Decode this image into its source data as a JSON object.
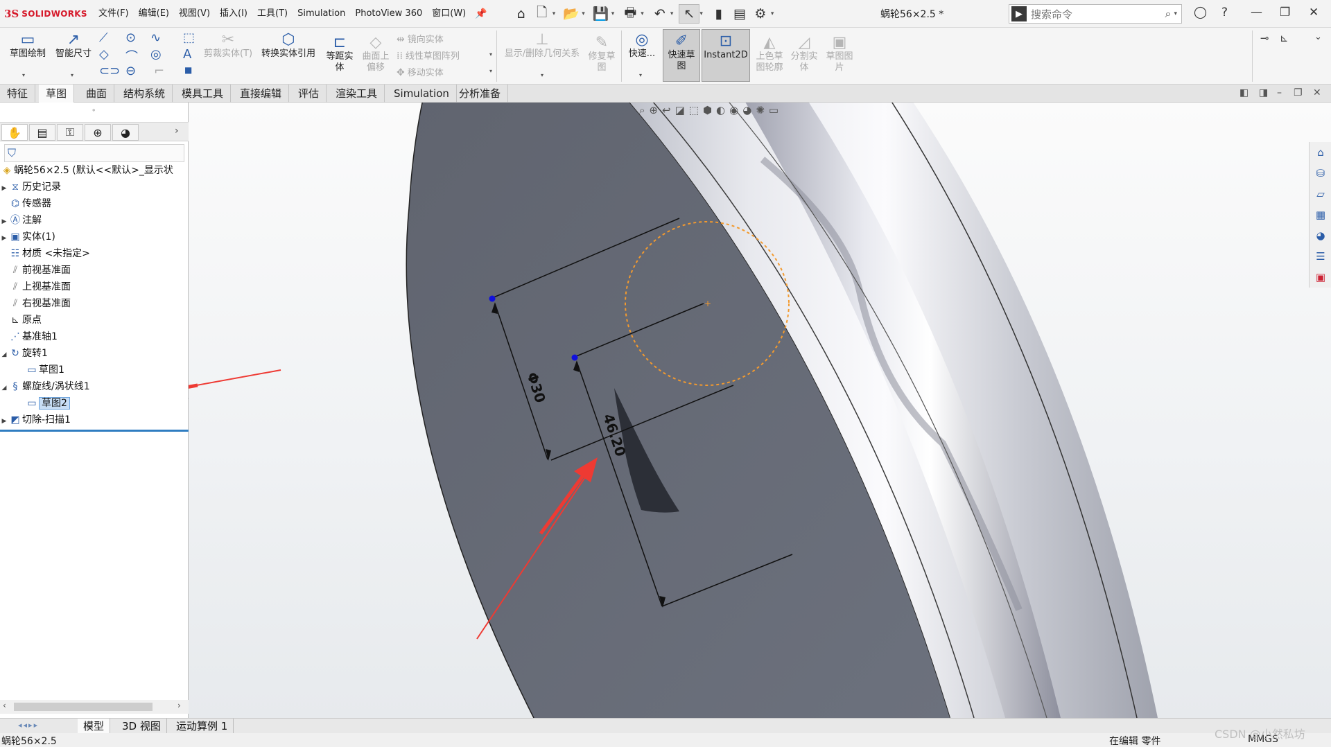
{
  "app": {
    "logo_prefix": "3S",
    "logo_name": "SOLIDWORKS",
    "document_title": "蜗轮56×2.5 *"
  },
  "menu": {
    "items": [
      "文件(F)",
      "编辑(E)",
      "视图(V)",
      "插入(I)",
      "工具(T)",
      "Simulation",
      "PhotoView 360",
      "窗口(W)"
    ]
  },
  "search": {
    "placeholder": "搜索命令"
  },
  "commands": {
    "sketch": "草图绘制",
    "smart_dim": "智能尺寸",
    "trim": "剪裁实体(T)",
    "convert": "转换实体引用",
    "offset_l1": "等距实",
    "offset_l2": "体",
    "offset_surf_l1": "曲面上",
    "offset_surf_l2": "偏移",
    "mirror": "镜向实体",
    "linear_pattern": "线性草图阵列",
    "move": "移动实体",
    "display_relations": "显示/删除几何关系",
    "repair_l1": "修复草",
    "repair_l2": "图",
    "quick_snap": "快速...",
    "rapid_sketch_l1": "快速草",
    "rapid_sketch_l2": "图",
    "instant2d": "Instant2D",
    "shaded_l1": "上色草",
    "shaded_l2": "图轮廓",
    "split_l1": "分割实",
    "split_l2": "体",
    "sketch_pic_l1": "草图图",
    "sketch_pic_l2": "片"
  },
  "tabs": [
    "特征",
    "草图",
    "曲面",
    "结构系统",
    "模具工具",
    "直接编辑",
    "评估",
    "渲染工具",
    "Simulation",
    "分析准备"
  ],
  "active_tab": "草图",
  "feature_tree": {
    "root": "蜗轮56×2.5  (默认<<默认>_显示状",
    "items": [
      {
        "label": "历史记录",
        "icon": "history-icon"
      },
      {
        "label": "传感器",
        "icon": "sensor-icon"
      },
      {
        "label": "注解",
        "icon": "annotation-icon"
      },
      {
        "label": "实体(1)",
        "icon": "solid-body-icon"
      },
      {
        "label": "材质 <未指定>",
        "icon": "material-icon"
      },
      {
        "label": "前视基准面",
        "icon": "plane-icon"
      },
      {
        "label": "上视基准面",
        "icon": "plane-icon"
      },
      {
        "label": "右视基准面",
        "icon": "plane-icon"
      },
      {
        "label": "原点",
        "icon": "origin-icon"
      },
      {
        "label": "基准轴1",
        "icon": "axis-icon"
      },
      {
        "label": "旋转1",
        "icon": "revolve-icon"
      },
      {
        "label": "草图1",
        "icon": "sketch-icon"
      },
      {
        "label": "螺旋线/涡状线1",
        "icon": "helix-icon"
      },
      {
        "label": "草图2",
        "icon": "sketch-icon"
      },
      {
        "label": "切除-扫描1",
        "icon": "cut-sweep-icon"
      }
    ]
  },
  "dimensions": {
    "d1": "Φ30",
    "d2": "46.20"
  },
  "bottom_tabs": [
    "模型",
    "3D 视图",
    "运动算例 1"
  ],
  "status": {
    "left": "蜗轮56×2.5",
    "mode": "在编辑 零件",
    "units": "MMGS",
    "watermark": "CSDN @小然私坊"
  },
  "colors": {
    "brand": "#d6192a",
    "arrow": "#ee3a33",
    "sketch_point": "#1010dd",
    "construction_circle": "#f39a2e",
    "face": "#676c78",
    "rim": "#c7cad3"
  }
}
